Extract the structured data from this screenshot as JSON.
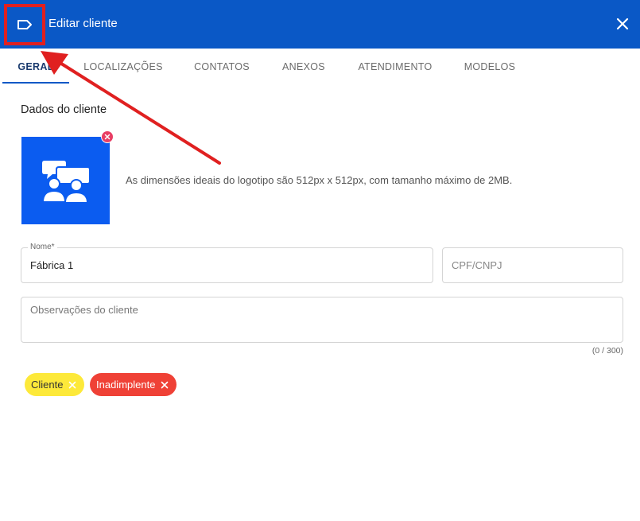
{
  "header": {
    "title": "Editar cliente",
    "tag_icon": "tag-icon",
    "close_icon": "close-icon",
    "bg_color": "#0a58c6"
  },
  "tabs": [
    {
      "label": "GERAL",
      "active": true
    },
    {
      "label": "LOCALIZAÇÕES",
      "active": false
    },
    {
      "label": "CONTATOS",
      "active": false
    },
    {
      "label": "ANEXOS",
      "active": false
    },
    {
      "label": "ATENDIMENTO",
      "active": false
    },
    {
      "label": "MODELOS",
      "active": false
    }
  ],
  "section": {
    "title": "Dados do cliente"
  },
  "logo": {
    "icon": "chat-people-icon",
    "remove_icon": "remove-icon",
    "hint": "As dimensões ideais do logotipo são 512px x 512px, com tamanho máximo de 2MB.",
    "bg_color": "#0b5cf0"
  },
  "form": {
    "name_label": "Nome*",
    "name_value": "Fábrica 1",
    "cpf_placeholder": "CPF/CNPJ",
    "notes_placeholder": "Observações do cliente",
    "notes_counter": "(0 / 300)"
  },
  "chips": [
    {
      "label": "Cliente",
      "color": "#fde93a",
      "text_color": "#333333"
    },
    {
      "label": "Inadimplente",
      "color": "#ef4136",
      "text_color": "#ffffff"
    }
  ],
  "annotation": {
    "color": "#e02020"
  }
}
